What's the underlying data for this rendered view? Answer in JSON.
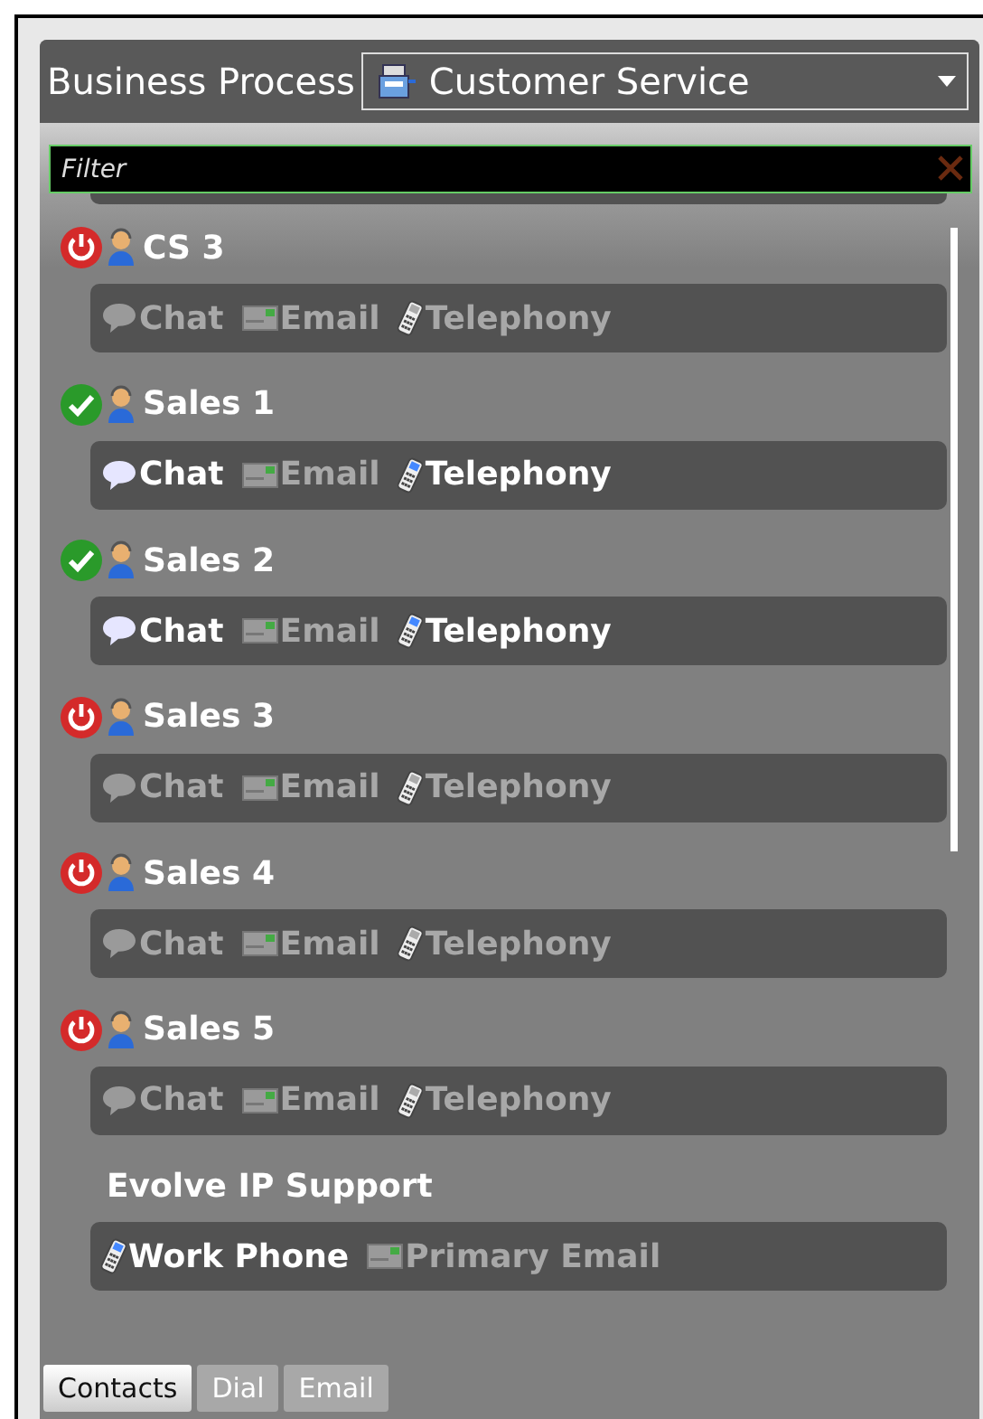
{
  "header": {
    "label": "Business Process",
    "dropdown": {
      "value": "Customer Service"
    }
  },
  "filter": {
    "placeholder": "Filter"
  },
  "contacts": [
    {
      "name": "CS 3",
      "online": false,
      "channels": [
        {
          "kind": "chat",
          "label": "Chat",
          "available": false
        },
        {
          "kind": "email",
          "label": "Email",
          "available": false
        },
        {
          "kind": "phone",
          "label": "Telephony",
          "available": false
        }
      ]
    },
    {
      "name": "Sales 1",
      "online": true,
      "channels": [
        {
          "kind": "chat",
          "label": "Chat",
          "available": true
        },
        {
          "kind": "email",
          "label": "Email",
          "available": false
        },
        {
          "kind": "phone",
          "label": "Telephony",
          "available": true
        }
      ]
    },
    {
      "name": "Sales 2",
      "online": true,
      "channels": [
        {
          "kind": "chat",
          "label": "Chat",
          "available": true
        },
        {
          "kind": "email",
          "label": "Email",
          "available": false
        },
        {
          "kind": "phone",
          "label": "Telephony",
          "available": true
        }
      ]
    },
    {
      "name": "Sales 3",
      "online": false,
      "channels": [
        {
          "kind": "chat",
          "label": "Chat",
          "available": false
        },
        {
          "kind": "email",
          "label": "Email",
          "available": false
        },
        {
          "kind": "phone",
          "label": "Telephony",
          "available": false
        }
      ]
    },
    {
      "name": "Sales 4",
      "online": false,
      "channels": [
        {
          "kind": "chat",
          "label": "Chat",
          "available": false
        },
        {
          "kind": "email",
          "label": "Email",
          "available": false
        },
        {
          "kind": "phone",
          "label": "Telephony",
          "available": false
        }
      ]
    },
    {
      "name": "Sales 5",
      "online": false,
      "channels": [
        {
          "kind": "chat",
          "label": "Chat",
          "available": false
        },
        {
          "kind": "email",
          "label": "Email",
          "available": false
        },
        {
          "kind": "phone",
          "label": "Telephony",
          "available": false
        }
      ]
    },
    {
      "name": "Evolve IP Support",
      "channels": [
        {
          "kind": "phone",
          "label": "Work Phone",
          "available": true
        },
        {
          "kind": "email",
          "label": "Primary Email",
          "available": false
        }
      ]
    }
  ],
  "tabs": [
    {
      "label": "Contacts",
      "selected": true
    },
    {
      "label": "Dial",
      "selected": false
    },
    {
      "label": "Email",
      "selected": false
    }
  ]
}
